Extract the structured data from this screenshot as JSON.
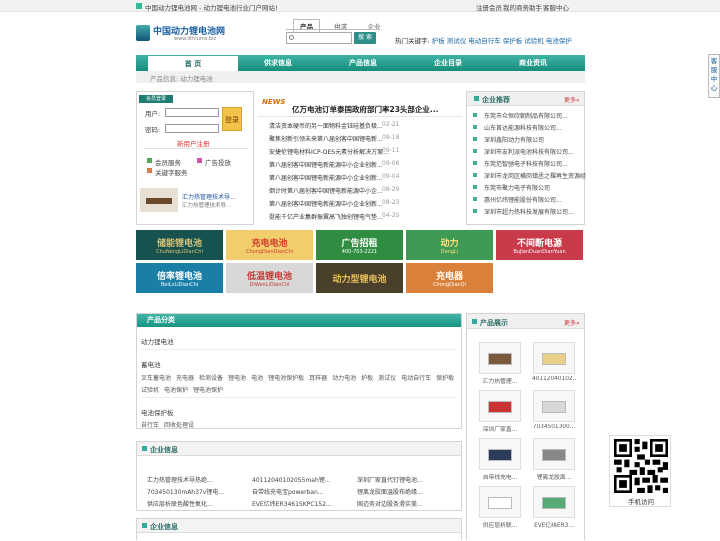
{
  "topbar": {
    "left": "中国动力锂电池网 - 动力锂电池行业门户网站!",
    "links": [
      "注册会员",
      "我的商务助手",
      "客服中心"
    ]
  },
  "logo": {
    "text": "中国动力锂电池网",
    "sub": "www.lithiums.biz"
  },
  "search": {
    "tabs": [
      "产品",
      "供求",
      "企业"
    ],
    "btn": "搜 索",
    "hot_label": "热门关键字:",
    "hot": [
      "护板",
      "测试仪",
      "电动自行车",
      "保护板",
      "试验机",
      "电池保护"
    ]
  },
  "nav": [
    "首 页",
    "供求信息",
    "产品信息",
    "企业目录",
    "商业资讯"
  ],
  "crumb": "产品信息: 动力锂电池",
  "login": {
    "tag": "会员登录",
    "user": "用户:",
    "pass": "密码:",
    "btn": "登录",
    "reg": "新用户注册",
    "links": [
      "会员服务",
      "广告投放",
      "关键字服务"
    ],
    "prod_title": "汇力热管理技术导...",
    "prod_sub": "汇力热管理技术导..."
  },
  "news": {
    "headline": "亿万电池订单泰国政府部门率23头部企业...",
    "tag": "NEWS",
    "items": [
      {
        "t": "清洁资本硬币的另一面物料金钰硅基负极...",
        "d": "02-21"
      },
      {
        "t": "聚焦创新引领未来第八届创客中国锂电新...",
        "d": "09-18"
      },
      {
        "t": "安捷伦锂电材料ICP-OES元素分析解决方案...",
        "d": "09-11"
      },
      {
        "t": "第八届创客中国锂电新能源中小企业创新...",
        "d": "09-06"
      },
      {
        "t": "第八届创客中国锂电新能源中小企业创新...",
        "d": "09-04"
      },
      {
        "t": "倒计时第八届创客中国锂电新能源中小企...",
        "d": "08-29"
      },
      {
        "t": "第八届创客中国锂电新能源中小企业创新...",
        "d": "08-23"
      },
      {
        "t": "挺能千亿产业集群振翼高飞独创锂电气垫...",
        "d": "04-25"
      }
    ]
  },
  "corp": {
    "title": "企业推荐",
    "more": "更多»",
    "items": [
      "东莞市众恒欣朝制品有限公司...",
      "山东首达能源科技有限公司...",
      "深圳鑫阳动力有限公司",
      "深圳市友利派电池科技有限公司...",
      "东莞范智驰电子科技有限公司...",
      "深圳市龙岗区横岗镇丞之棵再生资源经",
      "东莞市聚力电子有限公司",
      "惠州亿纬锂能股份有限公司...",
      "深圳市超力热科技发展有限公司..."
    ]
  },
  "banners": [
    {
      "t": "储能锂电池",
      "s": "ChuNengLiDianChi",
      "bg": "#17524f",
      "fg": "#d7c276"
    },
    {
      "t": "充电电池",
      "s": "ChongDianDianChi",
      "bg": "#f2cd6c",
      "fg": "#d03b2b"
    },
    {
      "t": "广告招租",
      "s": "400-703-2221",
      "bg": "#2f8c40",
      "fg": "#fff"
    },
    {
      "t": "动力",
      "s": "DongLi",
      "bg": "#3e9a55",
      "fg": "#ffe07a"
    },
    {
      "t": "不间断电源",
      "s": "BuJianDuanDianYuan",
      "bg": "#c93a4b",
      "fg": "#fff"
    },
    {
      "t": "倍率锂电池",
      "s": "BeiLvLiDianChi",
      "bg": "#197fa6",
      "fg": "#fff"
    },
    {
      "t": "低温锂电池",
      "s": "DiWenLiDianChi",
      "bg": "#d8d8d8",
      "fg": "#c23b34"
    },
    {
      "t": "动力型锂电池",
      "s": "",
      "bg": "#4a3f2b",
      "fg": "#e8c05c"
    },
    {
      "t": "充电器",
      "s": "ChongDianQi",
      "bg": "#d9803a",
      "fg": "#fff"
    }
  ],
  "catbox": {
    "title": "产品分类",
    "groups": [
      {
        "h": "动力锂电池",
        "items": []
      },
      {
        "h": "蓄电池",
        "items": [
          "叉车蓄电池",
          "充电器",
          "检测设备",
          "锂电池",
          "电池",
          "锂电池保护板",
          "耳样器",
          "动力电池",
          "护板",
          "测试仪",
          "电动自行车",
          "保护板"
        ]
      },
      {
        "h": "",
        "items": [
          "试验机",
          "电池保护",
          "锂电池保护"
        ]
      },
      {
        "h": "电池保护板",
        "items": [
          "自行车",
          "回收处理设"
        ]
      }
    ]
  },
  "corpinfo": {
    "title": "企业信息",
    "items": [
      "汇力热管理技术导热绝...",
      "40112040102055mah锂...",
      "深圳厂家直代钉锂电池...",
      "703450130mAh37v锂电...",
      "自带线充电宝powerban...",
      "锂离龙胶面温股布绝缘...",
      "供应层析联色酸性氧化...",
      "EVE亿纬ER34615KPC152...",
      "国迈务对边股条滑实美..."
    ]
  },
  "corpinfo2": {
    "title": "企业信息"
  },
  "products": {
    "title": "产品展示",
    "more": "更多»",
    "items": [
      "汇力热管理...",
      "40112040102...",
      "深圳厂家直...",
      "7034501300...",
      "自带线充电...",
      "锂离龙胶面...",
      "供应层析联...",
      "EVE亿纬ER3..."
    ]
  },
  "float": {
    "kefu": "客服中心",
    "qr": "手机访问"
  }
}
